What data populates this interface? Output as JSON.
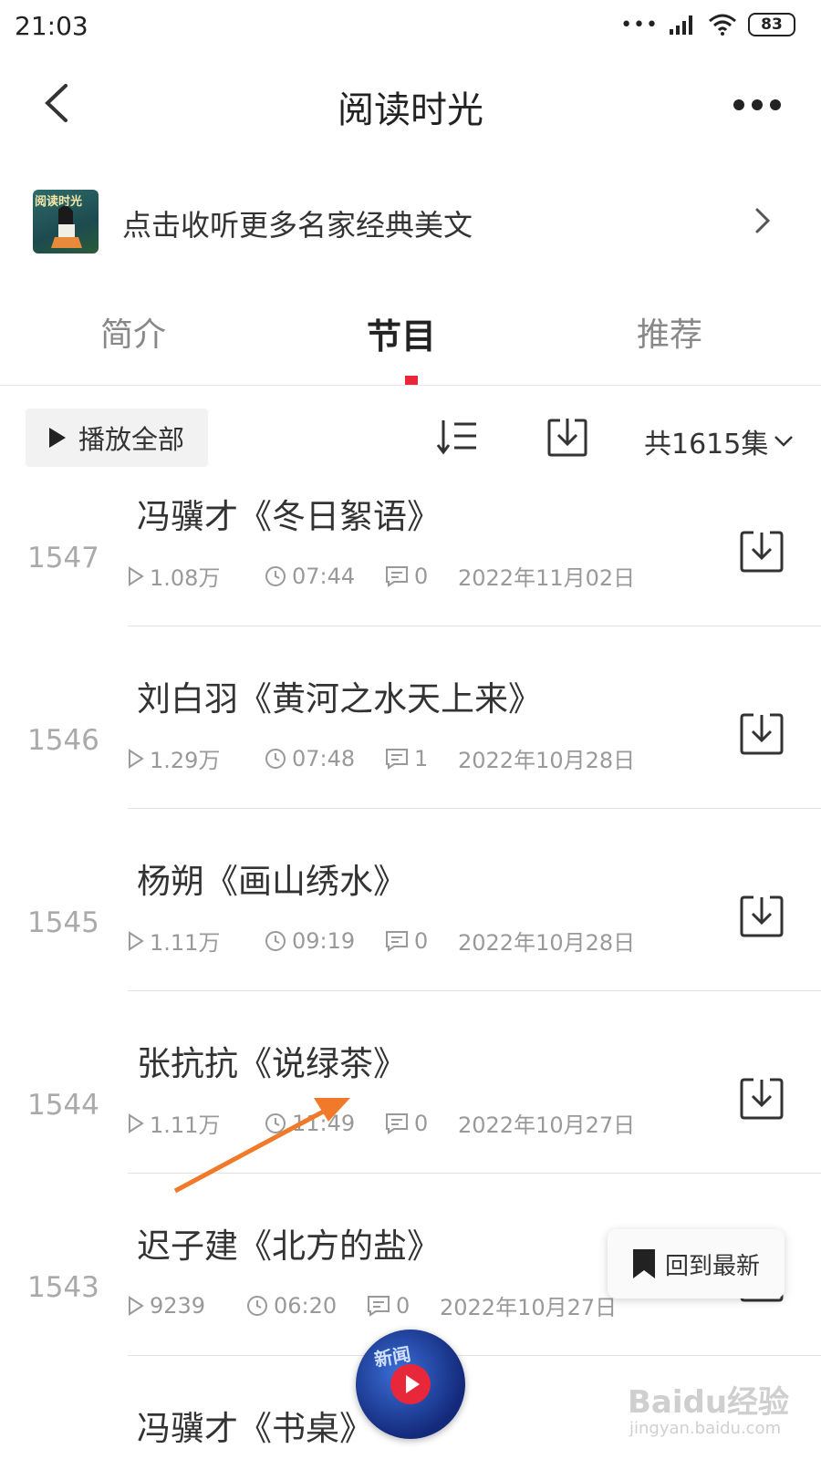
{
  "status_bar": {
    "time": "21:03",
    "signal_dots": "•••",
    "battery": "83"
  },
  "header": {
    "title": "阅读时光"
  },
  "banner": {
    "thumb_text": "阅读时光",
    "text": "点击收听更多名家经典美文"
  },
  "tabs": [
    {
      "label": "简介",
      "active": false
    },
    {
      "label": "节目",
      "active": true
    },
    {
      "label": "推荐",
      "active": false
    }
  ],
  "toolbar": {
    "play_all": "播放全部",
    "total": "共1615集"
  },
  "episodes": [
    {
      "num": "1547",
      "title": "冯骥才《冬日絮语》",
      "plays": "1.08万",
      "duration": "07:44",
      "comments": "0",
      "date": "2022年11月02日"
    },
    {
      "num": "1546",
      "title": "刘白羽《黄河之水天上来》",
      "plays": "1.29万",
      "duration": "07:48",
      "comments": "1",
      "date": "2022年10月28日"
    },
    {
      "num": "1545",
      "title": "杨朔《画山绣水》",
      "plays": "1.11万",
      "duration": "09:19",
      "comments": "0",
      "date": "2022年10月28日"
    },
    {
      "num": "1544",
      "title": "张抗抗《说绿茶》",
      "plays": "1.11万",
      "duration": "11:49",
      "comments": "0",
      "date": "2022年10月27日"
    },
    {
      "num": "1543",
      "title": "迟子建《北方的盐》",
      "plays": "9239",
      "duration": "06:20",
      "comments": "0",
      "date": "2022年10月27日"
    },
    {
      "num": "",
      "title": "冯骥才《书桌》",
      "plays": "",
      "duration": "",
      "comments": "",
      "date": ""
    }
  ],
  "back_to_latest": "回到最新",
  "player_label": "新闻",
  "watermark": {
    "main": "Baidu经验",
    "sub": "jingyan.baidu.com"
  },
  "colors": {
    "accent": "#e8283a",
    "annotation_arrow": "#f07a2a"
  }
}
